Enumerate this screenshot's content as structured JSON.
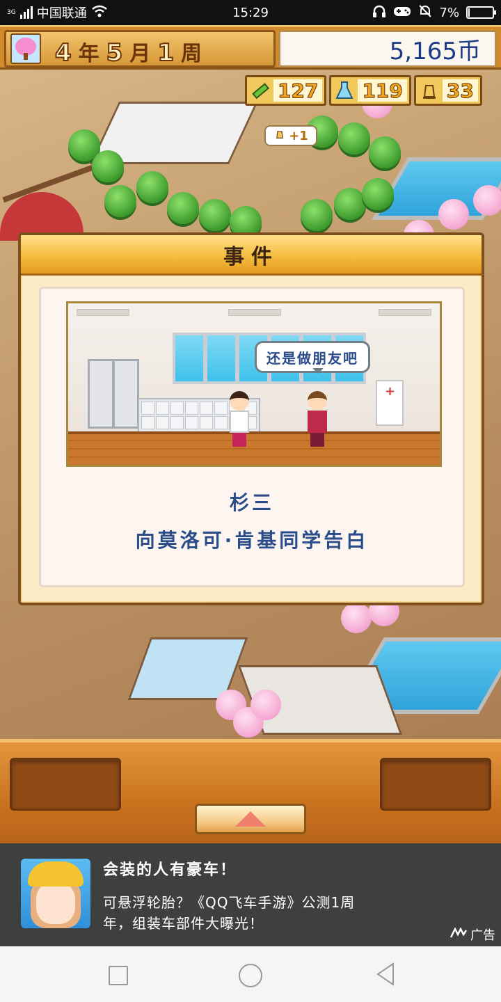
{
  "status_bar": {
    "network": "3G",
    "carrier": "中国联通",
    "time": "15:29",
    "battery": "7%",
    "battery_level": 0.07
  },
  "hud": {
    "year_num": "4",
    "year_unit": "年",
    "month_num": "5",
    "month_unit": "月",
    "week_num": "1",
    "week_unit": "周",
    "money": "5,165币"
  },
  "resources": {
    "items": [
      {
        "icon": "pencil-icon",
        "value": "127"
      },
      {
        "icon": "flask-icon",
        "value": "119"
      },
      {
        "icon": "bell-icon",
        "value": "33"
      }
    ],
    "bubble": "+1"
  },
  "dialog": {
    "title": "事件",
    "speech": "还是做朋友吧",
    "name": "杉三",
    "description": "向莫洛可·肯基同学告白"
  },
  "ad": {
    "title": "会装的人有豪车！",
    "body": "可悬浮轮胎？《QQ飞车手游》公测1周年，组装车部件大曝光！",
    "badge": "广告"
  }
}
